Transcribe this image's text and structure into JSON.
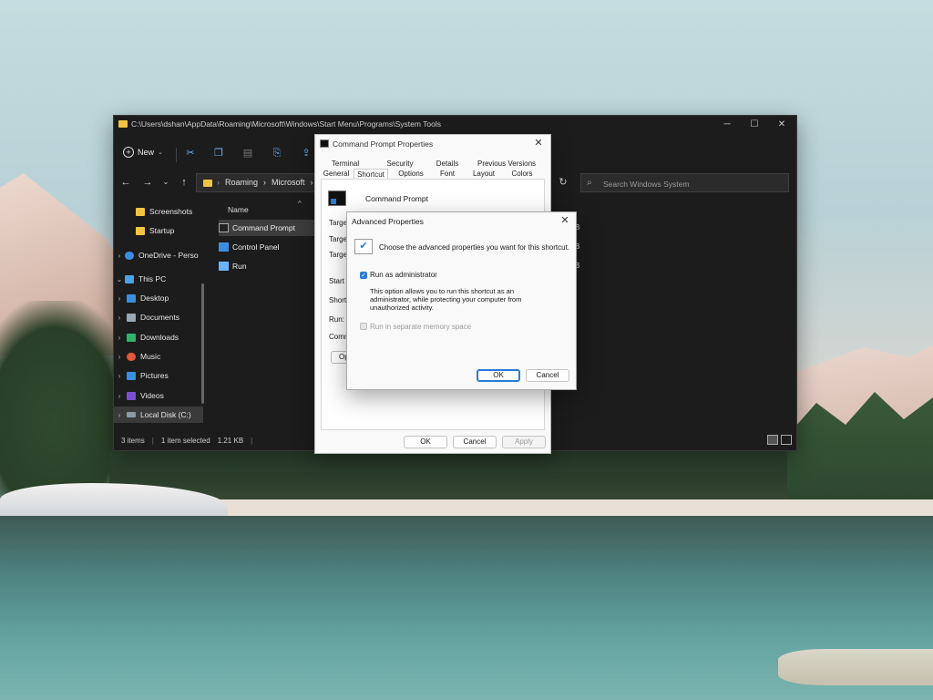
{
  "explorer": {
    "title_path": "C:\\Users\\dshan\\AppData\\Roaming\\Microsoft\\Windows\\Start Menu\\Programs\\System Tools",
    "new_label": "New",
    "breadcrumb": [
      "Roaming",
      "›",
      "Microsoft",
      "›",
      "W"
    ],
    "search_placeholder": "Search Windows System",
    "sidebar": [
      {
        "label": "Screenshots",
        "icon": "folder-icon",
        "color": "#f2c443",
        "chevron": ""
      },
      {
        "label": "Startup",
        "icon": "folder-icon",
        "color": "#f2c443",
        "chevron": ""
      },
      {
        "label": "OneDrive - Perso",
        "icon": "cloud-icon",
        "color": "#3b8fe0",
        "chevron": "›"
      },
      {
        "label": "This PC",
        "icon": "computer-icon",
        "color": "#4ba3e3",
        "chevron": "⌄"
      },
      {
        "label": "Desktop",
        "icon": "desktop-icon",
        "color": "#3b8fe0",
        "chevron": "›"
      },
      {
        "label": "Documents",
        "icon": "documents-icon",
        "color": "#9aa7b5",
        "chevron": "›"
      },
      {
        "label": "Downloads",
        "icon": "downloads-icon",
        "color": "#2fb36b",
        "chevron": "›"
      },
      {
        "label": "Music",
        "icon": "music-icon",
        "color": "#e0573a",
        "chevron": "›"
      },
      {
        "label": "Pictures",
        "icon": "pictures-icon",
        "color": "#3b8fe0",
        "chevron": "›"
      },
      {
        "label": "Videos",
        "icon": "videos-icon",
        "color": "#7b4fd1",
        "chevron": "›"
      },
      {
        "label": "Local Disk (C:)",
        "icon": "drive-icon",
        "color": "#8a9aa8",
        "chevron": "›"
      }
    ],
    "column_name": "Name",
    "files": [
      {
        "label": "Command Prompt"
      },
      {
        "label": "Control Panel"
      },
      {
        "label": "Run"
      }
    ],
    "size_fragments": [
      "B",
      "B",
      "B"
    ],
    "status": {
      "items": "3 items",
      "selected": "1 item selected",
      "size": "1.21 KB",
      "sep": "|"
    }
  },
  "props": {
    "title": "Command Prompt Properties",
    "tabs_top": [
      "Terminal",
      "Security",
      "Details",
      "Previous Versions"
    ],
    "tabs_bottom": [
      "General",
      "Shortcut",
      "Options",
      "Font",
      "Layout",
      "Colors"
    ],
    "active_tab": "Shortcut",
    "shortcut_name": "Command Prompt",
    "labels": [
      "Target",
      "Target",
      "Target",
      "Start in",
      "Shortcut",
      "Run:",
      "Comme"
    ],
    "obscured_button": "Op",
    "buttons": {
      "ok": "OK",
      "cancel": "Cancel",
      "apply": "Apply"
    }
  },
  "advanced": {
    "title": "Advanced Properties",
    "message": "Choose the advanced properties you want for this shortcut.",
    "run_as_admin": {
      "label": "Run as administrator",
      "checked": true
    },
    "description": "This option allows you to run this shortcut as an administrator, while protecting your computer from unauthorized activity.",
    "separate_memory": {
      "label": "Run in separate memory space",
      "checked": false,
      "disabled": true
    },
    "buttons": {
      "ok": "OK",
      "cancel": "Cancel"
    }
  },
  "colors": {
    "accent": "#2a7bd6",
    "explorer_bg": "#1c1c1c",
    "folder": "#f2c443"
  }
}
